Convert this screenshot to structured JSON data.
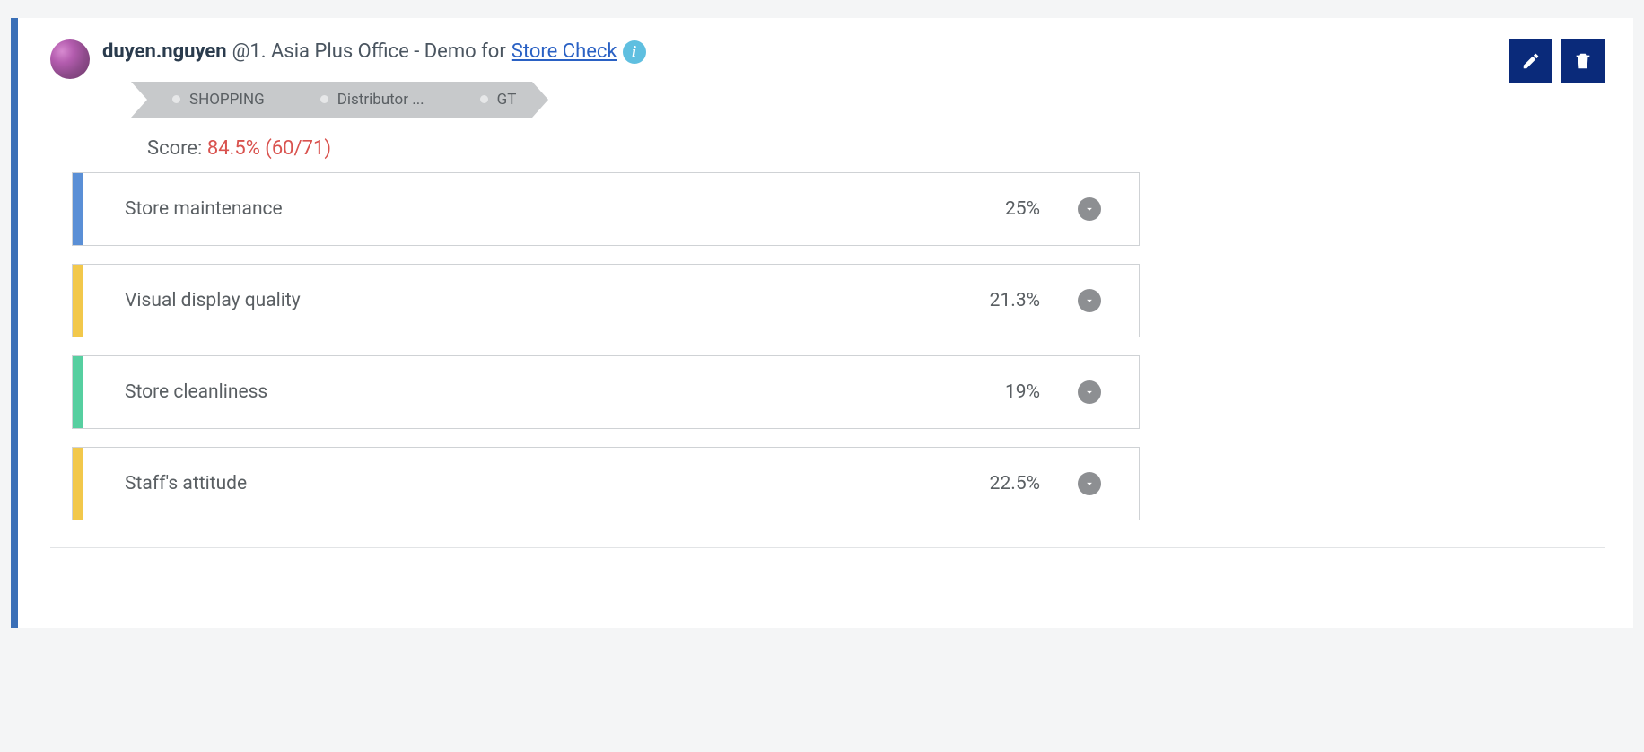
{
  "header": {
    "user": "duyen.nguyen",
    "location": "@1. Asia Plus Office",
    "sep": " - ",
    "demo_for_text": "Demo for",
    "store_link_text": "Store Check",
    "info_glyph": "i"
  },
  "crumbs": [
    {
      "label": "SHOPPING"
    },
    {
      "label": "Distributor ..."
    },
    {
      "label": "GT"
    }
  ],
  "score": {
    "label": "Score: ",
    "value": "84.5% (60/71)"
  },
  "rows": [
    {
      "label": "Store maintenance",
      "pct": "25%",
      "color": "#5a8fd6"
    },
    {
      "label": "Visual display quality",
      "pct": "21.3%",
      "color": "#f2c84b"
    },
    {
      "label": "Store cleanliness",
      "pct": "19%",
      "color": "#56cfa0"
    },
    {
      "label": "Staff's attitude",
      "pct": "22.5%",
      "color": "#f2c84b"
    }
  ]
}
